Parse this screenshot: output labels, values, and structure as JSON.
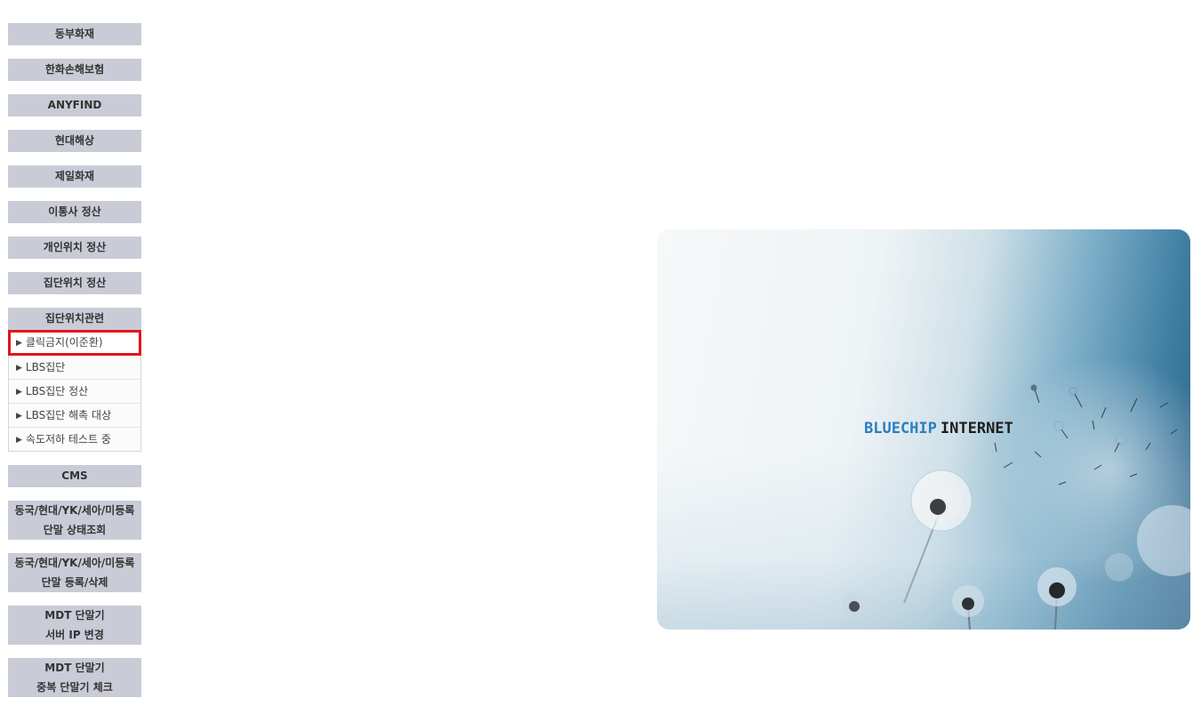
{
  "sidebar": {
    "buttons": [
      {
        "label": "동부화재"
      },
      {
        "label": "한화손해보험"
      },
      {
        "label": "ANYFIND"
      },
      {
        "label": "현대해상"
      },
      {
        "label": "제일화재"
      },
      {
        "label": "이통사 정산"
      },
      {
        "label": "개인위치 정산"
      },
      {
        "label": "집단위치 정산"
      },
      {
        "label": "집단위치관련"
      }
    ],
    "submenu": [
      {
        "label": "클릭금지(이준환)",
        "selected": true
      },
      {
        "label": "LBS집단"
      },
      {
        "label": "LBS집단 정산"
      },
      {
        "label": "LBS집단 해촉 대상"
      },
      {
        "label": "속도저하 테스트 중"
      }
    ],
    "buttons_after": [
      {
        "line1": "CMS"
      },
      {
        "line1": "동국/현대/YK/세아/미등록",
        "line2": "단말 상태조회"
      },
      {
        "line1": "동국/현대/YK/세아/미등록",
        "line2": "단말 등록/삭제"
      },
      {
        "line1": "MDT 단말기",
        "line2": "서버 IP 변경"
      },
      {
        "line1": "MDT 단말기",
        "line2": "중복 단말기 체크"
      }
    ],
    "arrow_glyph": "▶",
    "selected_outline_color": "#e3141b",
    "button_bg": "#c9ccd6"
  },
  "banner": {
    "logo_part1": "BLUECHIP",
    "logo_part2": "INTERNET",
    "logo_color_blue": "#2a7fc0",
    "logo_color_dark": "#1d1d1d",
    "image": "dandelion-seeds-illustration"
  }
}
